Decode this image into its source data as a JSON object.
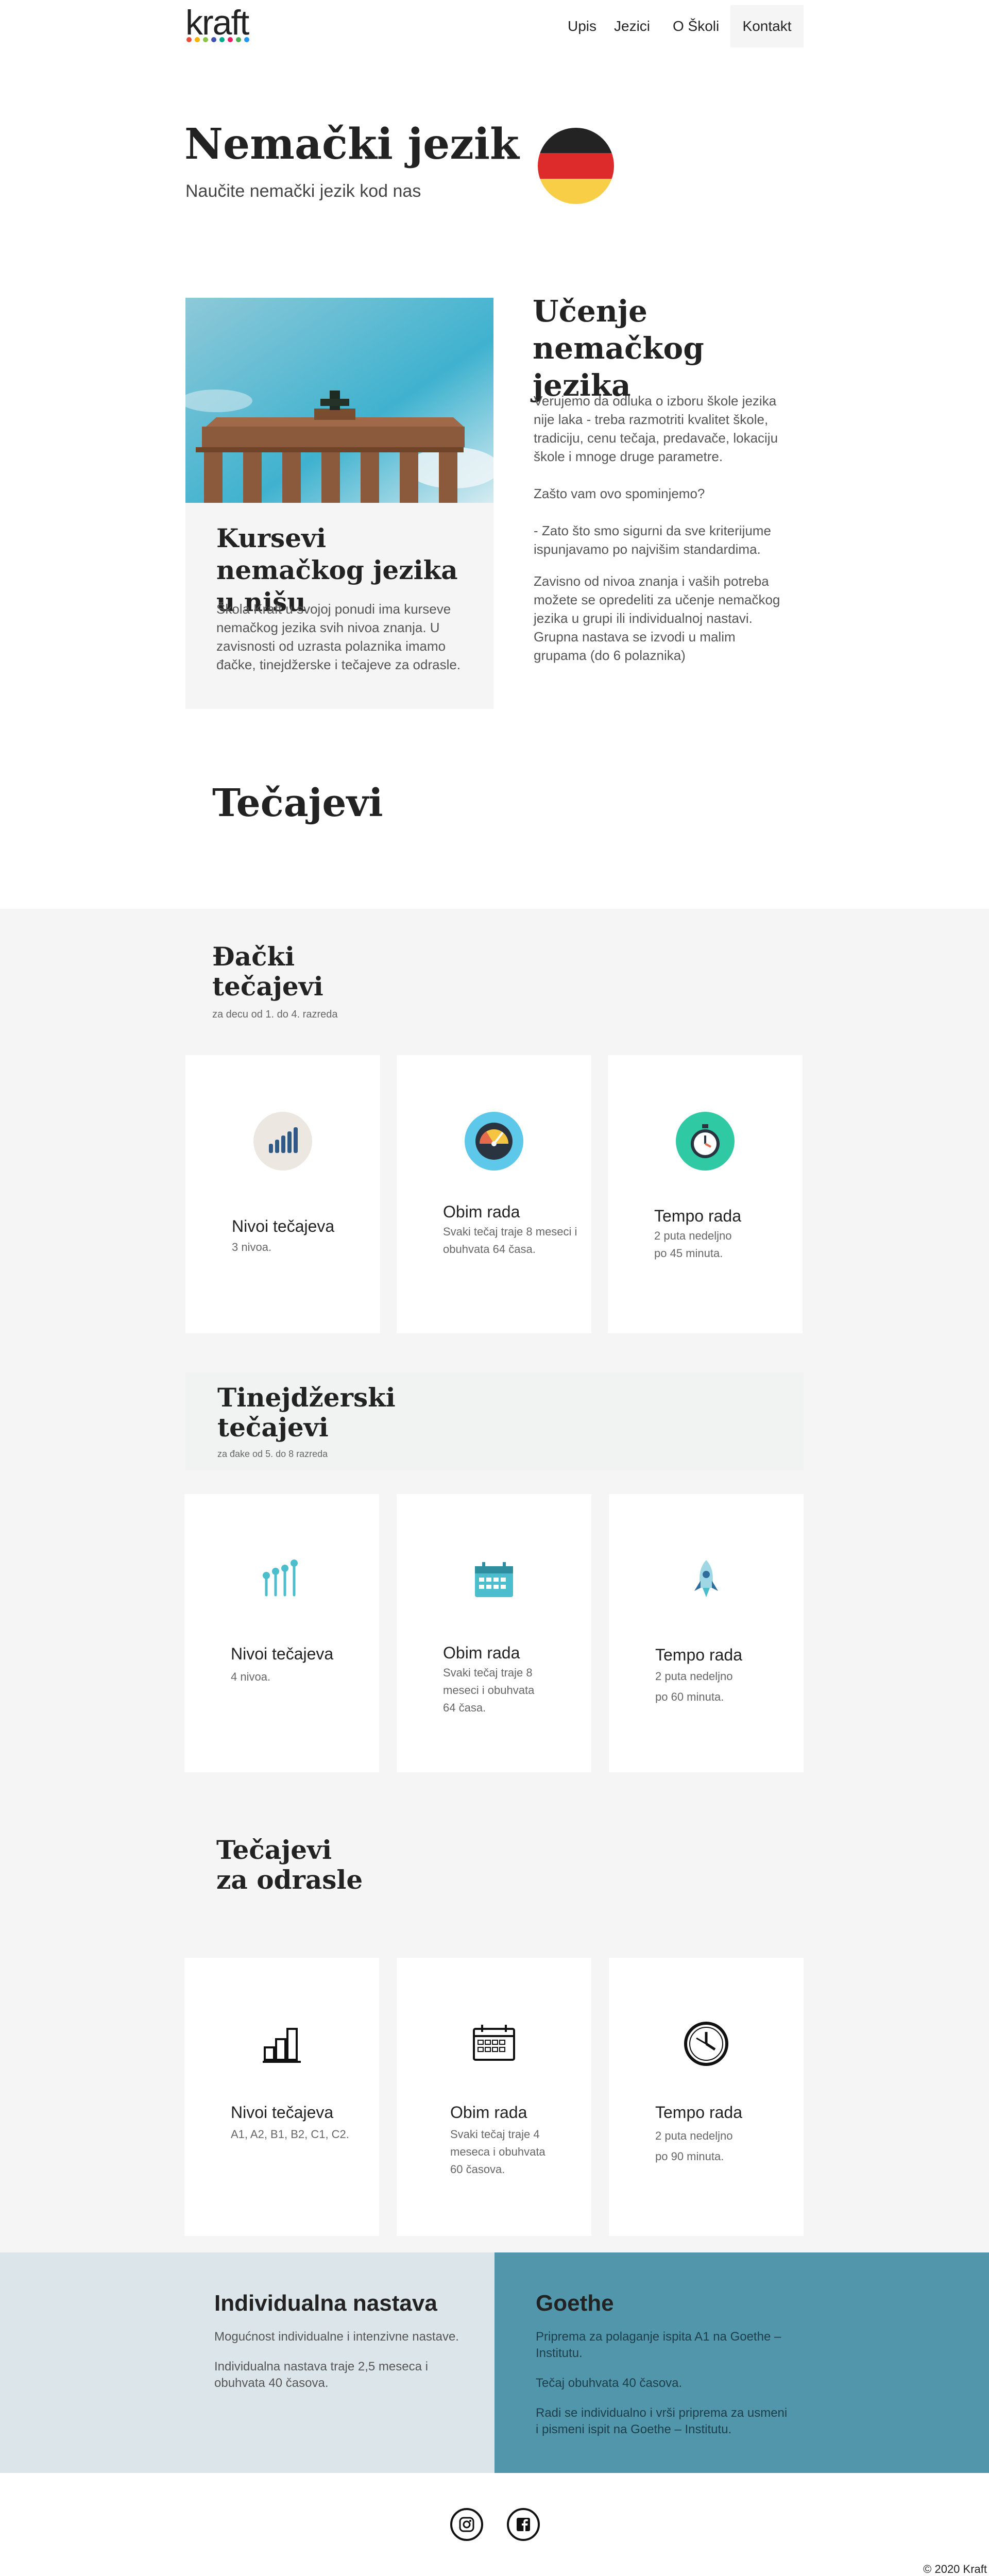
{
  "header": {
    "logo": "kraft",
    "logo_dot_colors": [
      "#e94e3d",
      "#f4b400",
      "#8bc34a",
      "#3f51b5",
      "#00a88f",
      "#e91e63",
      "#4caf50",
      "#2196f3"
    ],
    "nav": [
      "Upis",
      "Jezici",
      "O Školi",
      "Kontakt"
    ]
  },
  "hero": {
    "title": "Nemački jezik",
    "subtitle": "Naučite nemački jezik kod nas",
    "flag_colors": [
      "#232323",
      "#dd2b2b",
      "#f8ce46"
    ]
  },
  "intro": {
    "card_title": "Kursevi nemačkog jezika u nišu",
    "card_text": "Škola Kraft u svojoj ponudi ima kurseve nemačkog jezika svih nivoa znanja. U zavisnosti od uzrasta polaznika imamo đačke, tinejdžerske i tečajeve za odrasle.",
    "right_title": "Učenje nemačkog jezika",
    "right_paragraphs": [
      "Verujemo da odluka o izboru škole jezika nije laka - treba razmotriti kvalitet škole, tradiciju, cenu tečaja, predavače, lokaciju škole i mnoge druge parametre.",
      "Zašto vam ovo spominjemo?",
      "- Zato što smo sigurni da sve kriterijume ispunjavamo po najvišim standardima.",
      "Zavisno od nivoa znanja i vaših potreba možete se opredeliti za učenje nemačkog jezika u grupi ili individualnoj nastavi. Grupna nastava se izvodi u malim grupama (do 6 polaznika)"
    ]
  },
  "courses_title": "Tečajevi",
  "groups": [
    {
      "title": "Đački tečajevi",
      "subtitle": "za decu od 1. do 4. razreda",
      "cards": [
        {
          "icon": "signal-bars-icon",
          "title": "Nivoi tečajeva",
          "text": "3 nivoa."
        },
        {
          "icon": "gauge-icon",
          "title": "Obim rada",
          "text": "Svaki tečaj traje 8 meseci i obuhvata 64 časa."
        },
        {
          "icon": "stopwatch-icon",
          "title": "Tempo rada",
          "text": "2 puta nedeljno po 45 minuta."
        }
      ]
    },
    {
      "title": "Tinejdžerski tečajevi",
      "subtitle": "za đake od 5. do 8 razreda",
      "cards": [
        {
          "icon": "equalizer-icon",
          "title": "Nivoi tečajeva",
          "text": "4 nivoa."
        },
        {
          "icon": "calendar-icon",
          "title": "Obim rada",
          "text": "Svaki tečaj traje 8 meseci i obuhvata 64 časa."
        },
        {
          "icon": "rocket-icon",
          "title": "Tempo rada",
          "text": "2 puta nedeljno po 60 minuta."
        }
      ]
    },
    {
      "title": "Tečajevi za odrasle",
      "subtitle": "",
      "cards": [
        {
          "icon": "bar-chart-icon",
          "title": "Nivoi tečajeva",
          "text": "A1, A2, B1, B2, C1, C2."
        },
        {
          "icon": "calendar-outline-icon",
          "title": "Obim rada",
          "text": "Svaki tečaj traje 4 meseca i obuhvata 60 časova."
        },
        {
          "icon": "clock-icon",
          "title": "Tempo rada",
          "text": "2 puta nedeljno po 90 minuta."
        }
      ]
    }
  ],
  "individual": {
    "title": "Individualna nastava",
    "paragraphs": [
      "Mogućnost individualne i intenzivne nastave.",
      "Individualna nastava traje 2,5 meseca i obuhvata 40 časova."
    ]
  },
  "goethe": {
    "title": "Goethe",
    "paragraphs": [
      "Priprema za polaganje ispita A1 na Goethe – Institutu.",
      "Tečaj obuhvata 40 časova.",
      "Radi se individualno i vrši priprema za usmeni i pismeni ispit na Goethe – Institutu."
    ]
  },
  "footer": {
    "social": [
      "instagram-icon",
      "facebook-icon"
    ],
    "copyright": "© 2020 Kraft"
  }
}
